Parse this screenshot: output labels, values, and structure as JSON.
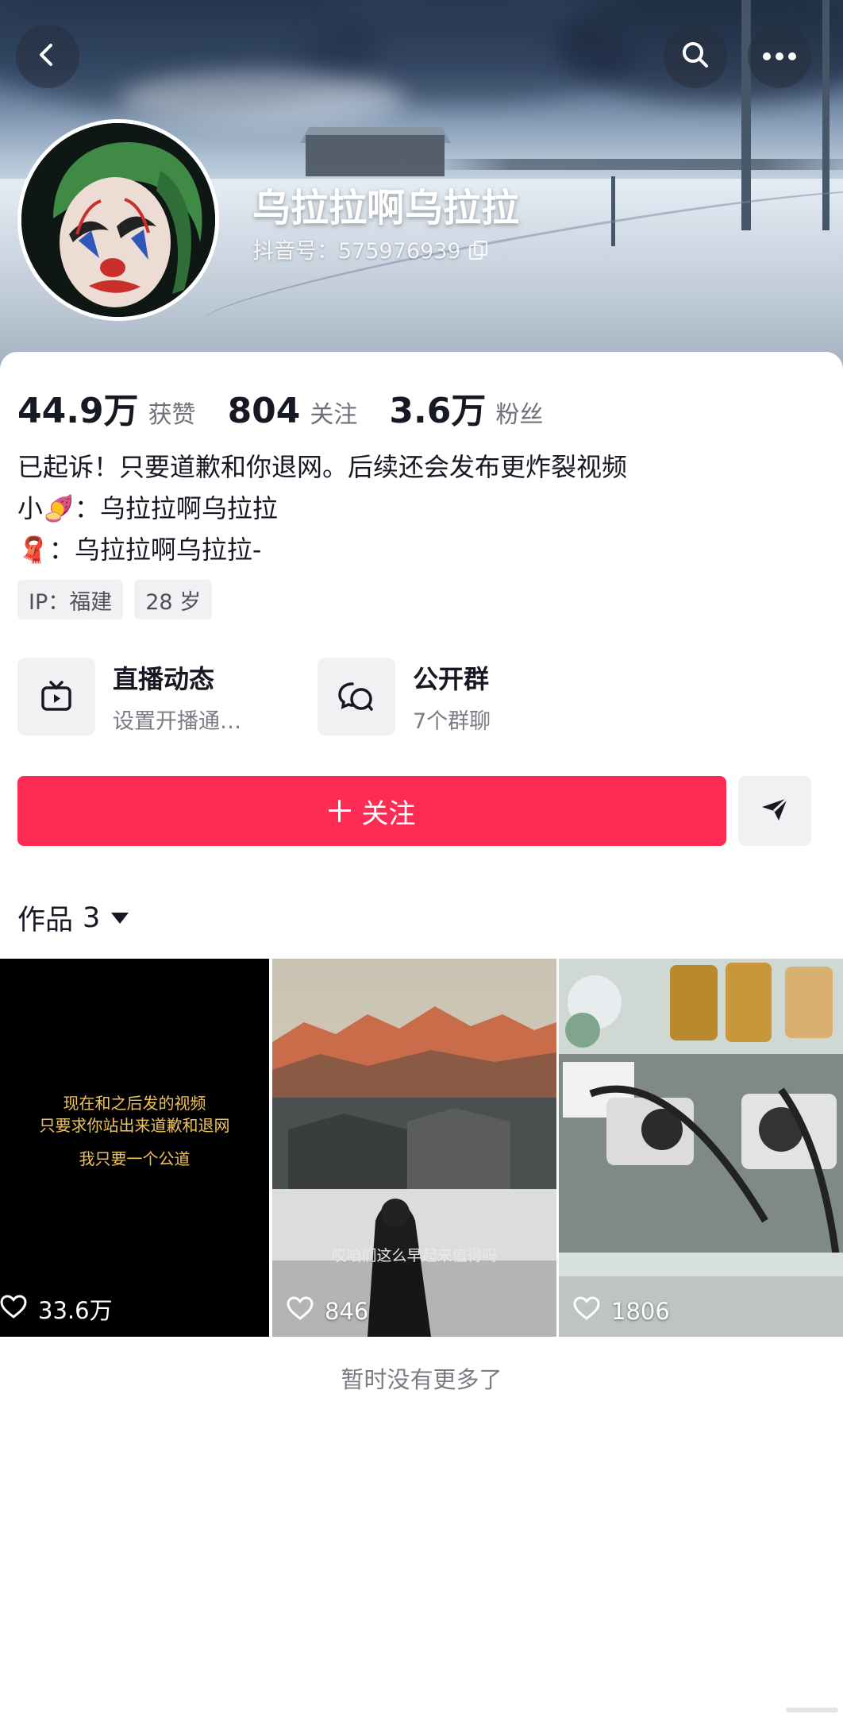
{
  "header": {
    "back_icon": "chevron-left-icon",
    "search_icon": "search-icon",
    "more_icon": "more-dots-icon"
  },
  "profile": {
    "nickname": "乌拉拉啊乌拉拉",
    "douyin_id": "抖音号：575976939",
    "copy_icon": "copy-icon"
  },
  "stats": [
    {
      "value": "44.9万",
      "label": "获赞"
    },
    {
      "value": "804",
      "label": "关注"
    },
    {
      "value": "3.6万",
      "label": "粉丝"
    }
  ],
  "bio": {
    "line1": "已起诉！只要道歉和你退网。后续还会发布更炸裂视频",
    "line2_prefix": "小",
    "line2_emoji": "🍠",
    "line2_text": "：乌拉拉啊乌拉拉",
    "line3_emoji": "🧣",
    "line3_text": "：乌拉拉啊乌拉拉-"
  },
  "tags": [
    "IP：福建",
    "28 岁"
  ],
  "features": [
    {
      "title": "直播动态",
      "subtitle": "设置开播通…",
      "icon": "live-tv-icon"
    },
    {
      "title": "公开群",
      "subtitle": "7个群聊",
      "icon": "group-chat-icon"
    }
  ],
  "actions": {
    "follow_label": "关注",
    "share_icon": "send-icon"
  },
  "works": {
    "tab_label": "作品",
    "count": "3",
    "items": [
      {
        "likes": "33.6万",
        "overlay_lines": [
          "现在和之后发的视频",
          "只要求你站出来道歉和退网",
          "我只要一个公道"
        ]
      },
      {
        "likes": "846",
        "caption": "哎咱们这么早起来值得吗"
      },
      {
        "likes": "1806"
      }
    ]
  },
  "footer": {
    "no_more": "暂时没有更多了"
  },
  "colors": {
    "accent": "#fe2c55",
    "text_primary": "#161823",
    "text_secondary": "#7b7c84",
    "chip_bg": "#f1f1f3"
  }
}
